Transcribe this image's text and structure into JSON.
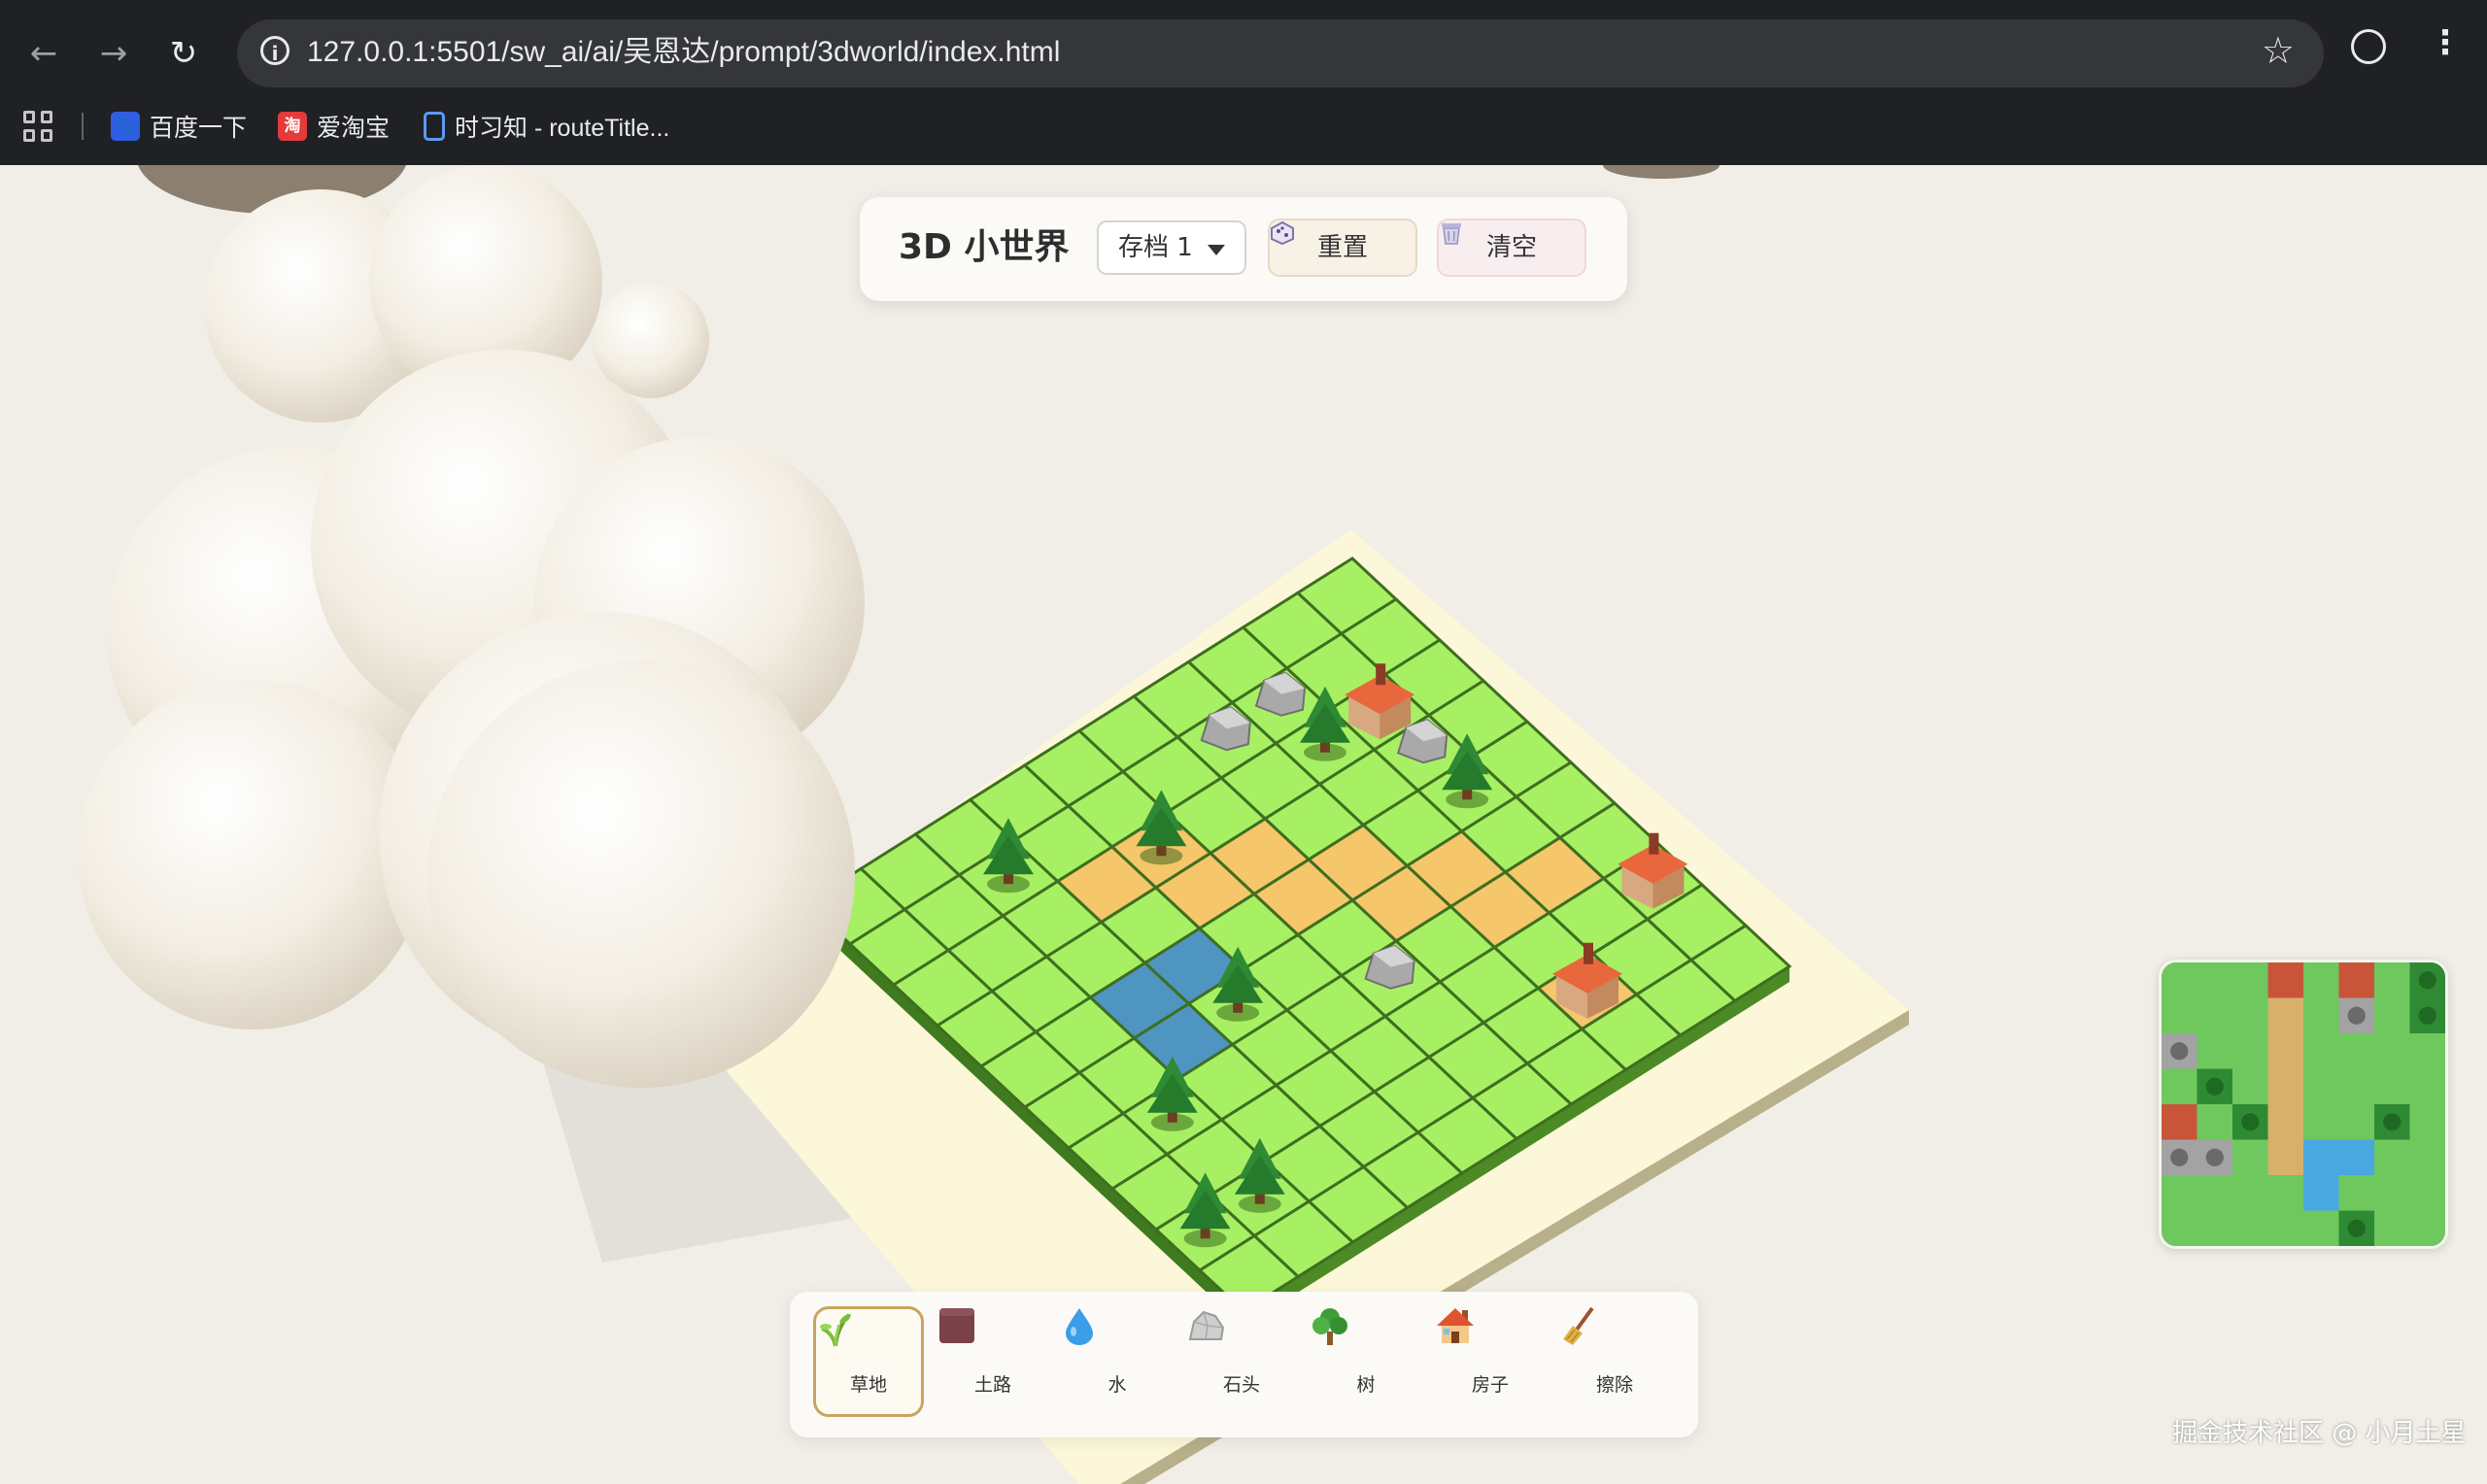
{
  "browser": {
    "url": "127.0.0.1:5501/sw_ai/ai/吴恩达/prompt/3dworld/index.html",
    "bookmarks": [
      {
        "label": "百度一下",
        "icon": "baidu-icon"
      },
      {
        "label": "爱淘宝",
        "icon": "taobao-icon"
      },
      {
        "label": "时习知 - routeTitle...",
        "icon": "book-icon"
      }
    ],
    "taobao_glyph": "淘"
  },
  "toolbar": {
    "title": "3D 小世界",
    "save_slot": "存档 1",
    "reset_label": "重置",
    "clear_label": "清空"
  },
  "palette": {
    "tools": [
      {
        "label": "草地",
        "icon": "grass-icon",
        "active": true
      },
      {
        "label": "土路",
        "icon": "dirt-icon",
        "active": false
      },
      {
        "label": "水",
        "icon": "water-drop-icon",
        "active": false
      },
      {
        "label": "石头",
        "icon": "rock-icon",
        "active": false
      },
      {
        "label": "树",
        "icon": "tree-icon",
        "active": false
      },
      {
        "label": "房子",
        "icon": "house-icon",
        "active": false
      },
      {
        "label": "擦除",
        "icon": "broom-icon",
        "active": false
      }
    ]
  },
  "watermark": "掘金技术社区 @ 小月土星",
  "colors": {
    "grass": "#a8f063",
    "grass_dark": "#5aa12f",
    "dirt": "#f5c66a",
    "water": "#4f95c2",
    "base": "#fffbe2",
    "house_roof": "#e8673c",
    "cloud": "#f5f1e8"
  }
}
